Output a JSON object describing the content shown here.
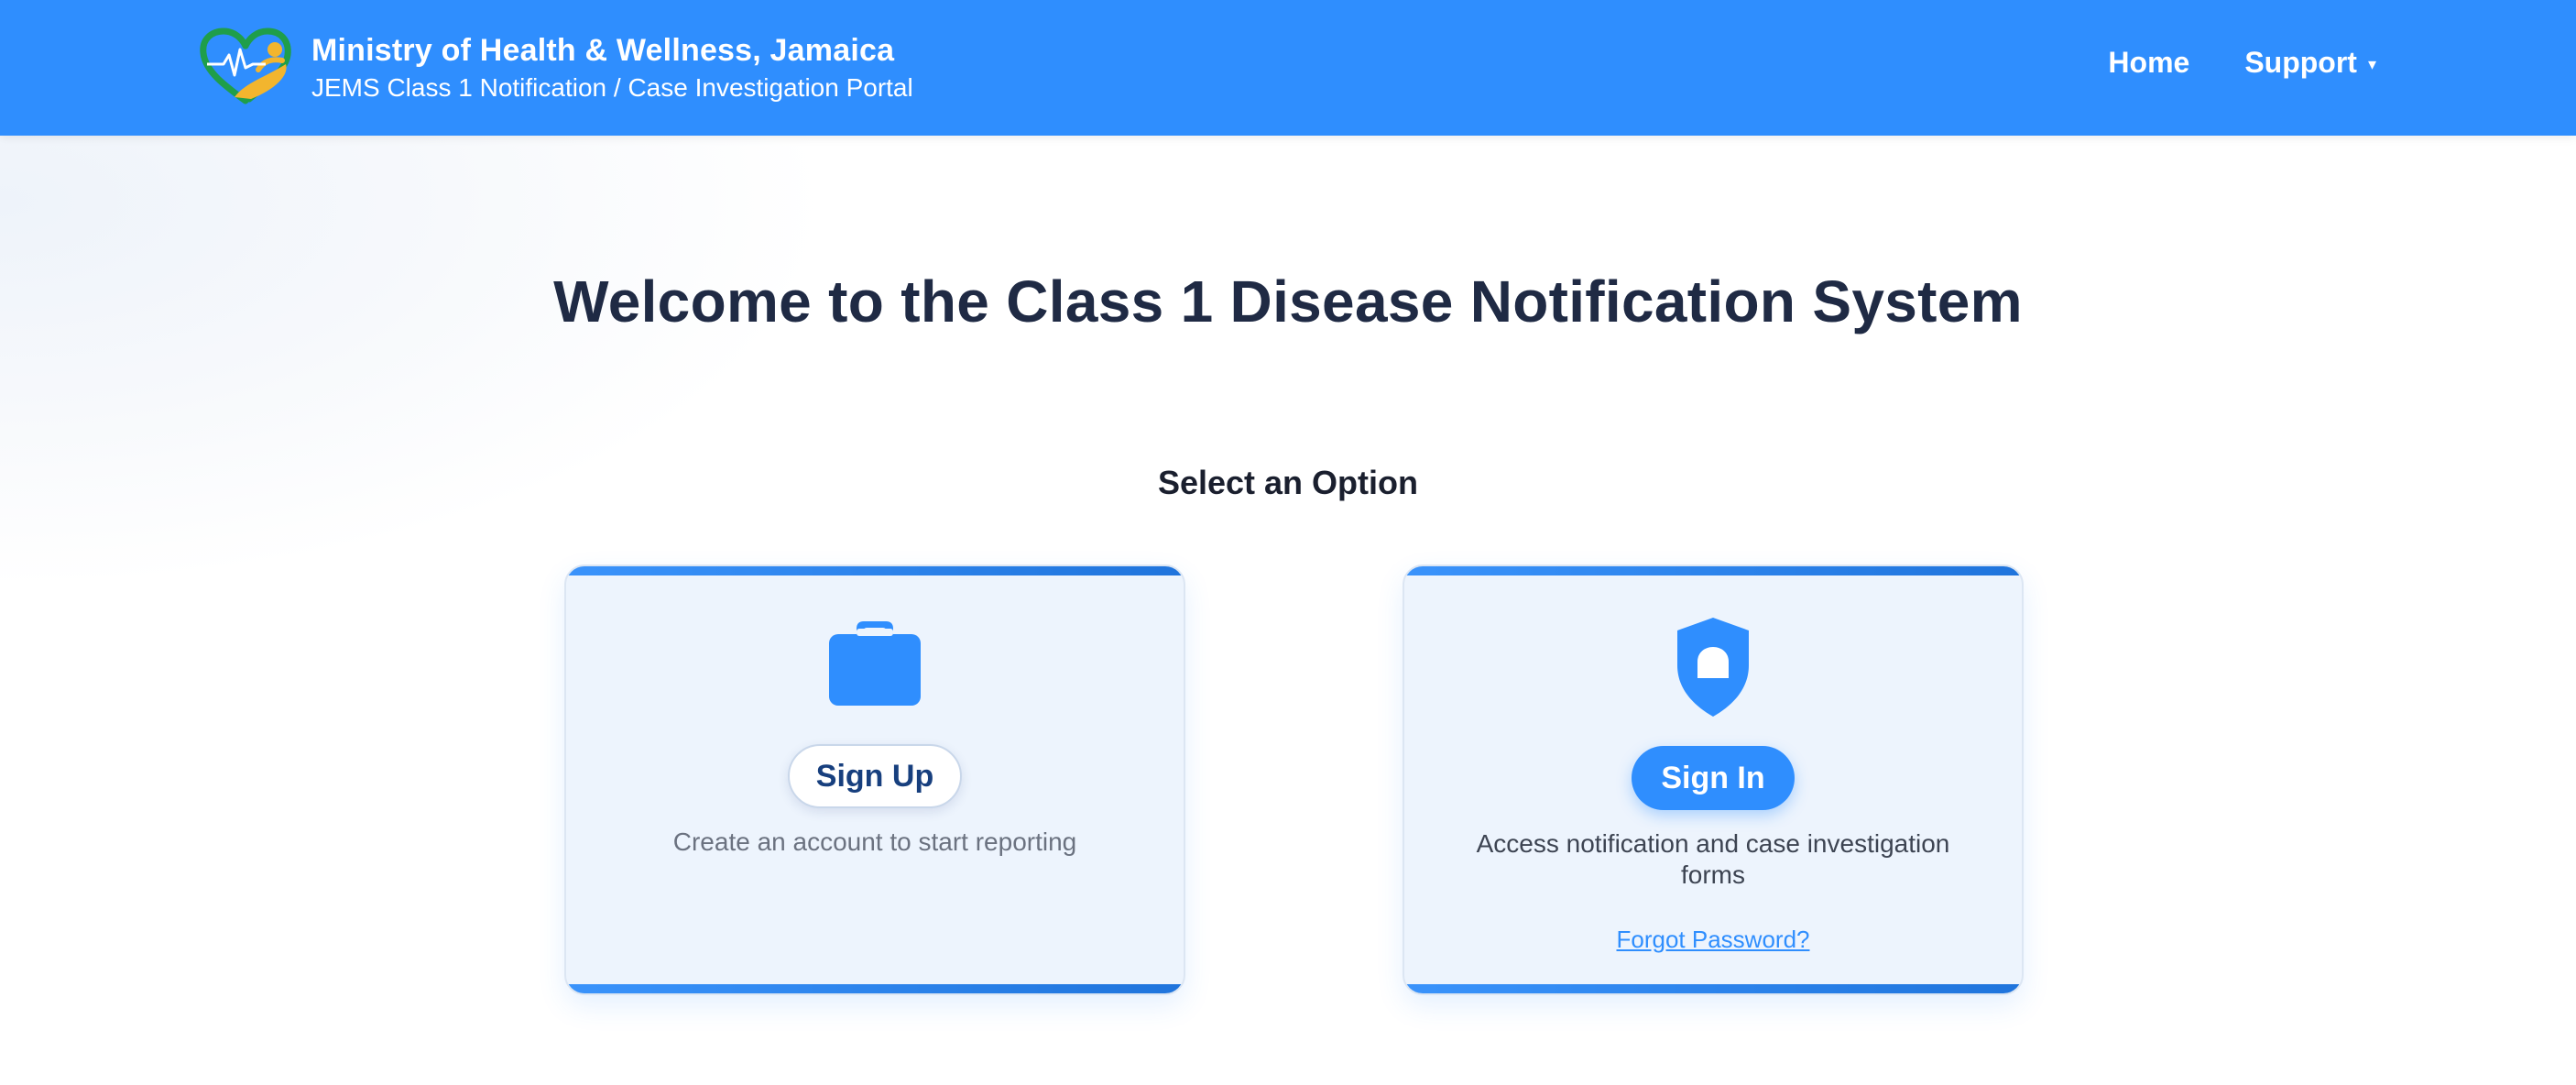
{
  "colors": {
    "header_bg": "#2f8efe",
    "accent": "#2f8efe",
    "heading": "#1f2a44",
    "card_bg": "#edf4fd"
  },
  "header": {
    "title": "Ministry of Health & Wellness, Jamaica",
    "subtitle": "JEMS Class 1 Notification / Case Investigation Portal",
    "logo_icon": "heart-heartbeat-logo",
    "nav": {
      "home": "Home",
      "support": "Support",
      "support_caret": "▾"
    }
  },
  "main": {
    "welcome": "Welcome to the Class 1 Disease Notification System",
    "select_prompt": "Select an Option",
    "cards": {
      "signup": {
        "icon": "briefcase-icon",
        "button": "Sign Up",
        "description": "Create an account to start reporting"
      },
      "signin": {
        "icon": "shield-icon",
        "button": "Sign In",
        "description": "Access notification and case investigation forms",
        "forgot": "Forgot Password?"
      }
    }
  }
}
